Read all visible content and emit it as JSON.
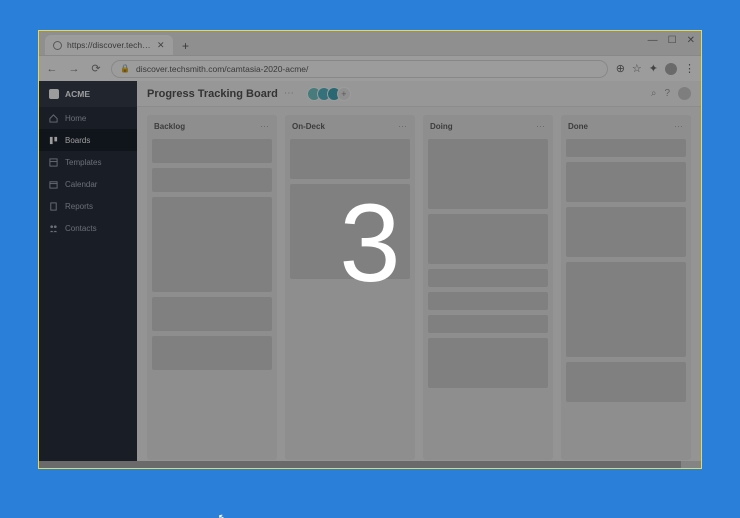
{
  "browser": {
    "tab_title": "https://discover.techsmith.com/...",
    "url": "discover.techsmith.com/camtasia-2020-acme/",
    "window_controls": {
      "min": "—",
      "max": "☐",
      "close": "✕"
    },
    "nav": {
      "back": "←",
      "forward": "→",
      "reload": "⟳"
    },
    "new_tab": "+",
    "right_icons": {
      "zoom": "⊕",
      "star": "☆",
      "ext": "✦",
      "menu": "⋮"
    }
  },
  "sidebar": {
    "brand": "ACME",
    "items": [
      {
        "label": "Home"
      },
      {
        "label": "Boards"
      },
      {
        "label": "Templates"
      },
      {
        "label": "Calendar"
      },
      {
        "label": "Reports"
      },
      {
        "label": "Contacts"
      }
    ]
  },
  "topbar": {
    "title": "Progress Tracking Board",
    "avatars_add": "+",
    "right": {
      "search": "⌕",
      "help": "?"
    }
  },
  "columns": [
    {
      "title": "Backlog"
    },
    {
      "title": "On-Deck"
    },
    {
      "title": "Doing"
    },
    {
      "title": "Done"
    }
  ],
  "ellipsis": "⋯",
  "countdown": "3"
}
